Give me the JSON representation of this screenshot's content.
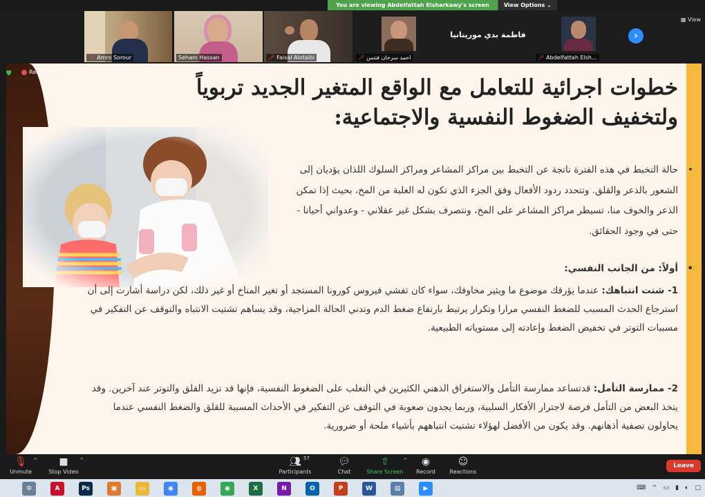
{
  "banner": {
    "viewing_text": "You are viewing Abdelfattah Elsharkawy's screen",
    "view_options": "View Options ⌄"
  },
  "strip": {
    "participants": [
      {
        "name": "Amro Sorour"
      },
      {
        "name": "Seham Hassan"
      },
      {
        "name": "Faisal Alotaibi"
      },
      {
        "name": "احمد سرحان فتنس"
      },
      {
        "name": "فاطمة بدي موريتانيا",
        "text_only": true
      },
      {
        "name": "Abdelfattah Elsh..."
      }
    ],
    "view_label": "View"
  },
  "recording": {
    "label": "Recording"
  },
  "slide": {
    "title_line1": "خطوات اجرائية للتعامل مع الواقع المتغير الجديد تربوياً",
    "title_line2": "ولتخفيف الضغوط النفسية والاجتماعية:",
    "bullet1": "حالة التخبط في هذه الفترة ناتجة عن التخبط بين مراكز المشاعر ومراكز السلوك اللذان يؤديان إلى الشعور بالذعر والقلق. وتتحدد ردود الأفعال وفق الجزء الذي تكون له الغلبة من المخ، بحيث إذا تمكن الذعر والخوف منا، تسيطر مراكز المشاعر على المخ، ونتصرف بشكل غير عقلاني - وعدواني أحيانا - حتى في وجود الحقائق.",
    "heading2": "أولاً: من الجانب النفسي:",
    "item1_lead": "1- شتت انتباهك:",
    "item1_text": " عندما يؤرقك موضوع ما ويثير مخاوفك، سواء كان تفشي فيروس كورونا المستجد أو تغير المناخ أو غير ذلك، لكن دراسة أشارت إلى أن استرجاع الحدث المسبب للضغط النفسي مرارا وتكرار يرتبط بارتفاع ضغط الدم وتدني الحالة المزاجية، وقد يساهم تشتيت الانتباه والتوقف عن التفكير في مسببات التوتر في تخفيض الضغط وإعادته إلى مستوياته الطبيعية.",
    "item2_lead": "2- ممارسة التأمل:",
    "item2_text": " قدتساعد ممارسة التأمل والاستغراق الذهني الكثيرين في التغلب على الضغوط النفسية، فإنها قد تزيد القلق والتوتر عند آخرين. وقد يتخذ البعض من التأمل فرصة لاجترار الأفكار السلبية، وربما يجدون صعوبة في التوقف عن التفكير في الأحداث المسببة للقلق والضغط النفسي عندما يحاولون تصفية أذهانهم. وقد يكون من الأفضل لهؤلاء تشتيت انتباههم بأشياء ملحة أو ضرورية."
  },
  "toolbar": {
    "unmute": "Unmute",
    "stop_video": "Stop Video",
    "participants": "Participants",
    "participants_count": "57",
    "chat": "Chat",
    "share_screen": "Share Screen",
    "record": "Record",
    "reactions": "Reactions",
    "leave": "Leave"
  },
  "taskbar": {
    "apps": [
      {
        "icon": "system-icon",
        "color": "#6b7f99",
        "glyph": "⚙"
      },
      {
        "icon": "acrobat-icon",
        "color": "#c8102e",
        "glyph": "A"
      },
      {
        "icon": "photoshop-icon",
        "color": "#0a2a4a",
        "glyph": "Ps"
      },
      {
        "icon": "photos-icon",
        "color": "#e07a2e",
        "glyph": "▣"
      },
      {
        "icon": "explorer-icon",
        "color": "#e8b93a",
        "glyph": "▭"
      },
      {
        "icon": "chrome-icon",
        "color": "#4285f4",
        "glyph": "◉"
      },
      {
        "icon": "firefox-icon",
        "color": "#e66000",
        "glyph": "◍"
      },
      {
        "icon": "chrome-alt-icon",
        "color": "#34a853",
        "glyph": "◉"
      },
      {
        "icon": "excel-icon",
        "color": "#1d6f42",
        "glyph": "X"
      },
      {
        "icon": "onenote-icon",
        "color": "#7719aa",
        "glyph": "N"
      },
      {
        "icon": "outlook-icon",
        "color": "#0a64ad",
        "glyph": "O"
      },
      {
        "icon": "powerpoint-icon",
        "color": "#c43e1c",
        "glyph": "P"
      },
      {
        "icon": "word-icon",
        "color": "#2b579a",
        "glyph": "W"
      },
      {
        "icon": "window-icon",
        "color": "#5a7fa8",
        "glyph": "▤"
      },
      {
        "icon": "zoom-icon",
        "color": "#2d8cff",
        "glyph": "▶"
      }
    ]
  }
}
